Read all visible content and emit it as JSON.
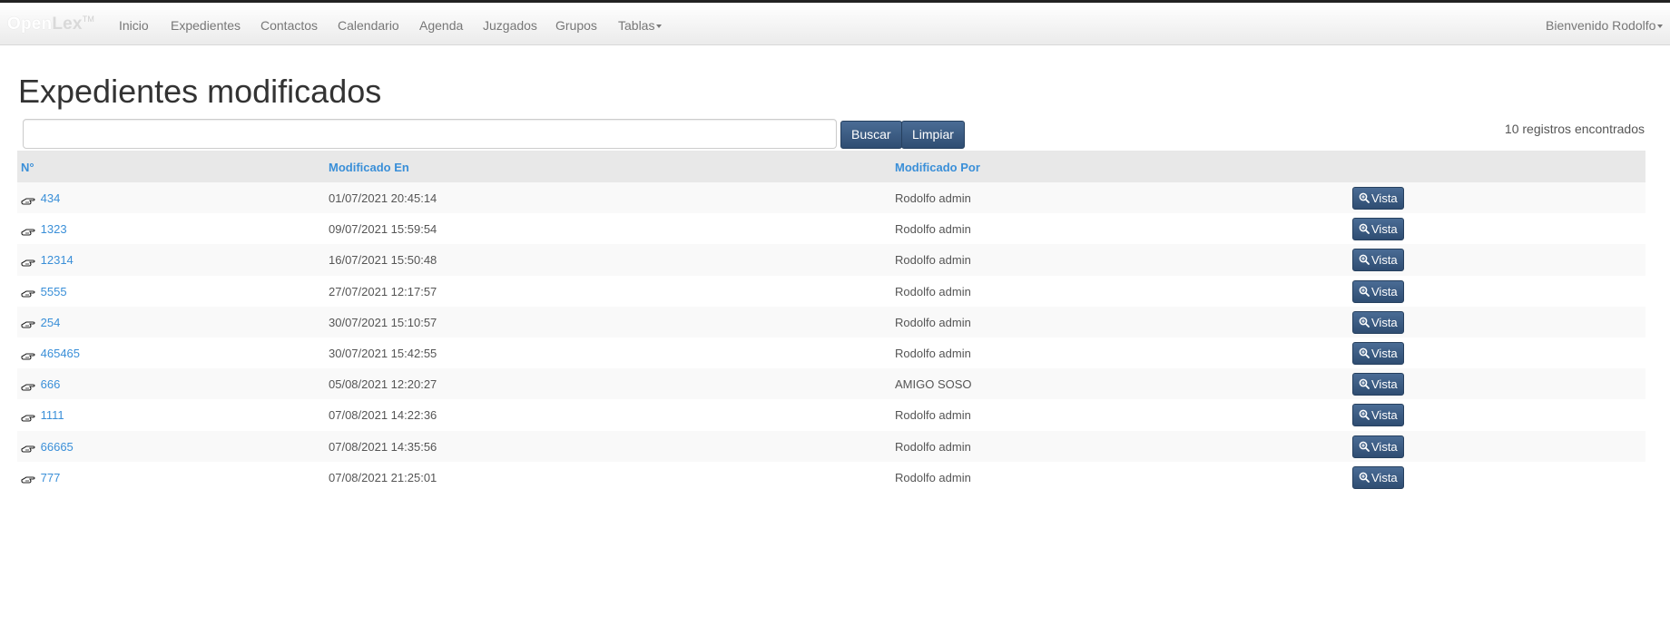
{
  "brand": {
    "open": "Open",
    "lex": "Lex",
    "tm": "TM"
  },
  "nav": {
    "items": [
      {
        "label": "Inicio"
      },
      {
        "label": "Expedientes"
      },
      {
        "label": "Contactos"
      },
      {
        "label": "Calendario"
      },
      {
        "label": "Agenda"
      },
      {
        "label": "Juzgados"
      },
      {
        "label": "Grupos"
      },
      {
        "label": "Tablas"
      }
    ],
    "user_menu": "Bienvenido Rodolfo"
  },
  "page": {
    "title": "Expedientes modificados"
  },
  "search": {
    "value": "",
    "placeholder": "",
    "buscar_label": "Buscar",
    "limpiar_label": "Limpiar",
    "records_text": "10 registros encontrados"
  },
  "table": {
    "headers": {
      "num": "N°",
      "modificado_en": "Modificado En",
      "modificado_por": "Modificado Por"
    },
    "rows": [
      {
        "num": "434",
        "date": "01/07/2021 20:45:14",
        "user": "Rodolfo admin",
        "action": "Vista"
      },
      {
        "num": "1323",
        "date": "09/07/2021 15:59:54",
        "user": "Rodolfo admin",
        "action": "Vista"
      },
      {
        "num": "12314",
        "date": "16/07/2021 15:50:48",
        "user": "Rodolfo admin",
        "action": "Vista"
      },
      {
        "num": "5555",
        "date": "27/07/2021 12:17:57",
        "user": "Rodolfo admin",
        "action": "Vista"
      },
      {
        "num": "254",
        "date": "30/07/2021 15:10:57",
        "user": "Rodolfo admin",
        "action": "Vista"
      },
      {
        "num": "465465",
        "date": "30/07/2021 15:42:55",
        "user": "Rodolfo admin",
        "action": "Vista"
      },
      {
        "num": "666",
        "date": "05/08/2021 12:20:27",
        "user": "AMIGO SOSO",
        "action": "Vista"
      },
      {
        "num": "1111",
        "date": "07/08/2021 14:22:36",
        "user": "Rodolfo admin",
        "action": "Vista"
      },
      {
        "num": "66665",
        "date": "07/08/2021 14:35:56",
        "user": "Rodolfo admin",
        "action": "Vista"
      },
      {
        "num": "777",
        "date": "07/08/2021 21:25:01",
        "user": "Rodolfo admin",
        "action": "Vista"
      }
    ]
  },
  "icons": {
    "row_icon": "pointing-hand-icon",
    "vista_icon": "zoom-in-icon",
    "caret_icon": "caret-down-icon"
  },
  "colors": {
    "link": "#3a8fd8",
    "button": "#3a5a82",
    "header_bg": "#e8e8e8"
  }
}
